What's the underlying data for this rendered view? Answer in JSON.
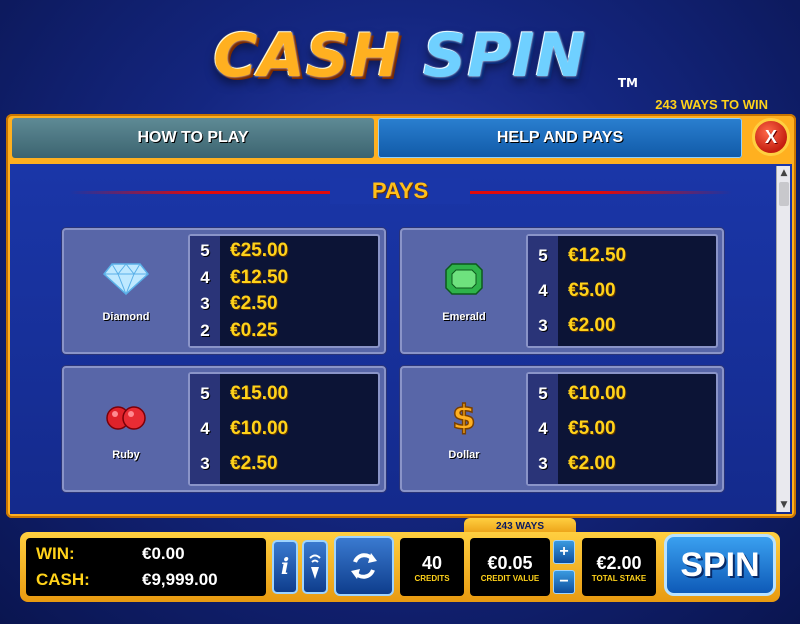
{
  "header": {
    "logo_word1": "CASH",
    "logo_word2": "SPIN",
    "trademark": "TM",
    "ways_label": "243 WAYS TO WIN"
  },
  "tabs": {
    "how_to_play": "HOW TO PLAY",
    "help_and_pays": "HELP AND PAYS",
    "close": "X"
  },
  "pays": {
    "title": "PAYS",
    "symbols": [
      {
        "name": "Diamond",
        "icon": "diamond-icon",
        "rows": [
          {
            "count": "5",
            "value": "€25.00"
          },
          {
            "count": "4",
            "value": "€12.50"
          },
          {
            "count": "3",
            "value": "€2.50"
          },
          {
            "count": "2",
            "value": "€0.25"
          }
        ]
      },
      {
        "name": "Emerald",
        "icon": "emerald-icon",
        "rows": [
          {
            "count": "5",
            "value": "€12.50"
          },
          {
            "count": "4",
            "value": "€5.00"
          },
          {
            "count": "3",
            "value": "€2.00"
          }
        ]
      },
      {
        "name": "Ruby",
        "icon": "ruby-icon",
        "rows": [
          {
            "count": "5",
            "value": "€15.00"
          },
          {
            "count": "4",
            "value": "€10.00"
          },
          {
            "count": "3",
            "value": "€2.50"
          }
        ]
      },
      {
        "name": "Dollar",
        "icon": "dollar-icon",
        "rows": [
          {
            "count": "5",
            "value": "€10.00"
          },
          {
            "count": "4",
            "value": "€5.00"
          },
          {
            "count": "3",
            "value": "€2.00"
          }
        ]
      }
    ]
  },
  "bottom_bar": {
    "win_label": "WIN:",
    "win_value": "€0.00",
    "cash_label": "CASH:",
    "cash_value": "€9,999.00",
    "info_icon": "info-icon",
    "sound_icon": "sound-icon",
    "autoplay_icon": "autoplay-icon",
    "credits_value": "40",
    "credits_label": "CREDITS",
    "ways_tab": "243 WAYS",
    "credit_value": "€0.05",
    "credit_value_label": "CREDIT VALUE",
    "increase": "+",
    "decrease": "−",
    "total_stake": "€2.00",
    "total_stake_label": "TOTAL STAKE",
    "spin_label": "SPIN"
  },
  "colors": {
    "accent_gold": "#ffb020",
    "value_yellow": "#ffd21a",
    "background_blue": "#142680",
    "button_blue": "#0e5ab8",
    "close_red": "#c51e10"
  }
}
